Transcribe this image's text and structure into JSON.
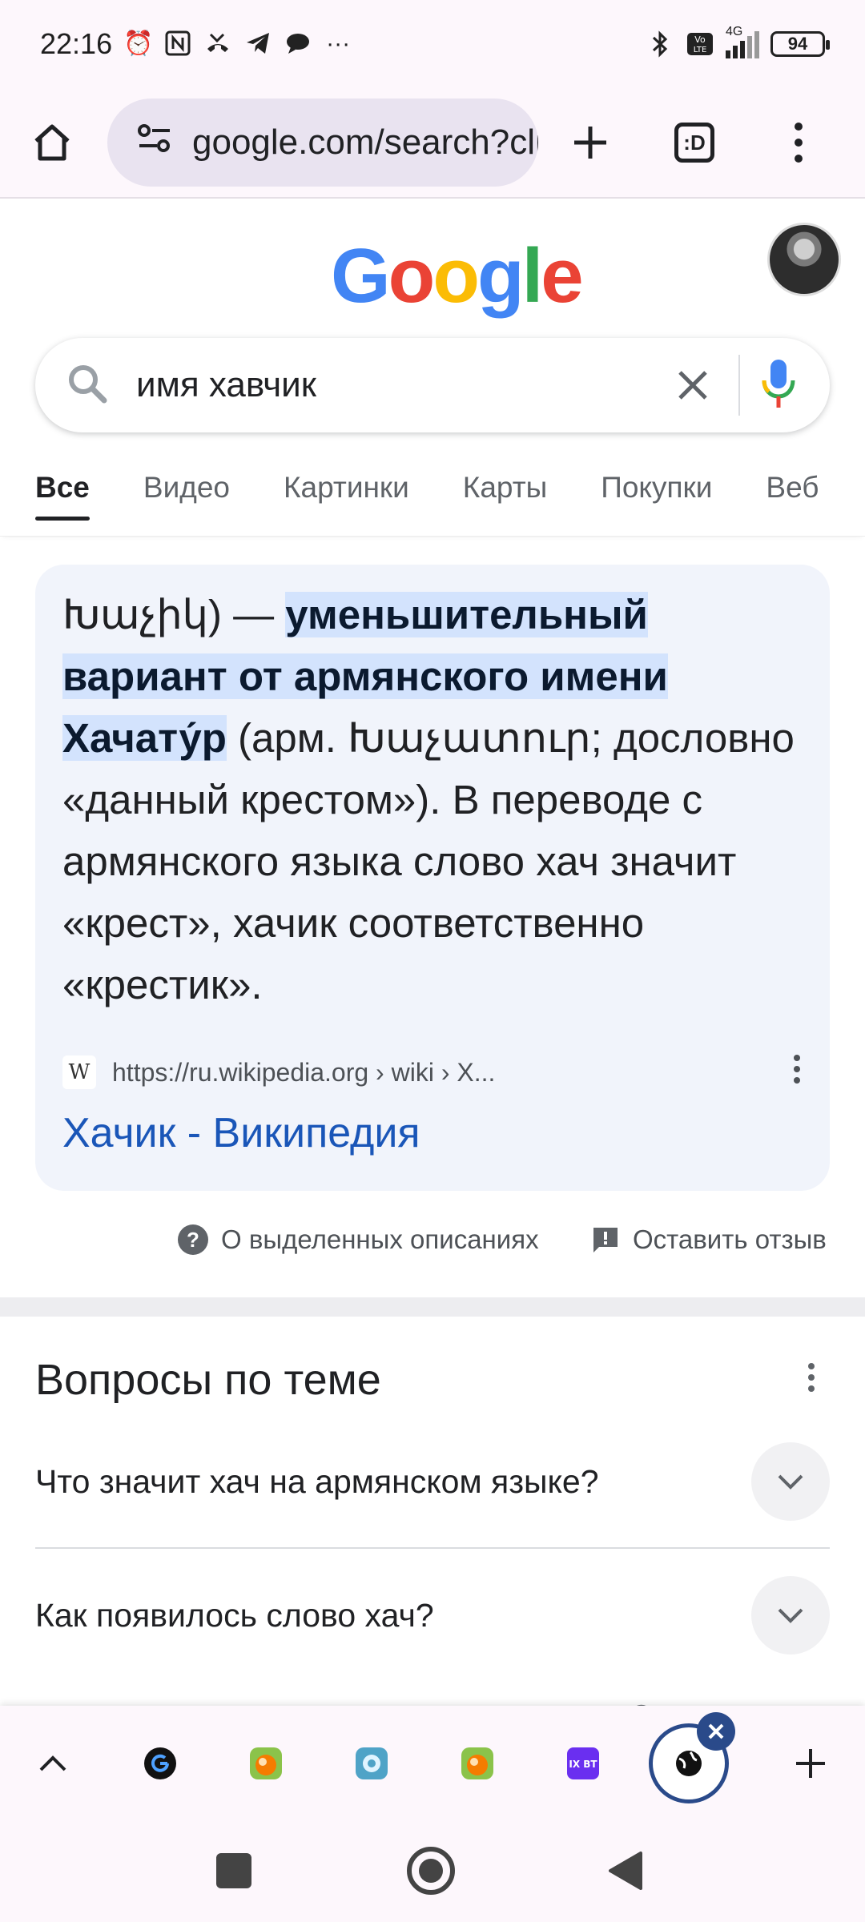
{
  "status_bar": {
    "time": "22:16",
    "battery": "94",
    "network": "4G"
  },
  "toolbar": {
    "url": "google.com/search?client",
    "tabs_label": ":D"
  },
  "google": {
    "logo_letters": [
      "G",
      "o",
      "o",
      "g",
      "l",
      "e"
    ],
    "logo_colors": [
      "#4285F4",
      "#EA4335",
      "#FBBC05",
      "#4285F4",
      "#34A853",
      "#EA4335"
    ]
  },
  "search": {
    "query": "имя хавчик"
  },
  "tabs": [
    "Все",
    "Видео",
    "Картинки",
    "Карты",
    "Покупки",
    "Веб"
  ],
  "snippet": {
    "part1": "Խաչիկ) — ",
    "highlight": "уменьшительный вариант от армянского имени Хачату́р",
    "part2": " (арм. Խաչատուր; дословно «данный крестом»). В переводе с армянского языка слово хач значит «крест», хачик соответственно «крестик».",
    "source_url": "https://ru.wikipedia.org › wiki › Х...",
    "favicon": "W",
    "link_title": "Хачик - Википедия"
  },
  "feedback": {
    "about": "О выделенных описаниях",
    "leave": "Оставить отзыв"
  },
  "questions": {
    "title": "Вопросы по теме",
    "items": [
      "Что значит хач на армянском языке?",
      "Как появилось слово хач?"
    ],
    "cut_text": "Оставить отзыв"
  },
  "tab_strip": {
    "ixbt_label": "IX BT"
  },
  "colors": {
    "accent": "#1a56b8",
    "highlight": "#d3e3fd",
    "card_bg": "#f1f4fb"
  }
}
